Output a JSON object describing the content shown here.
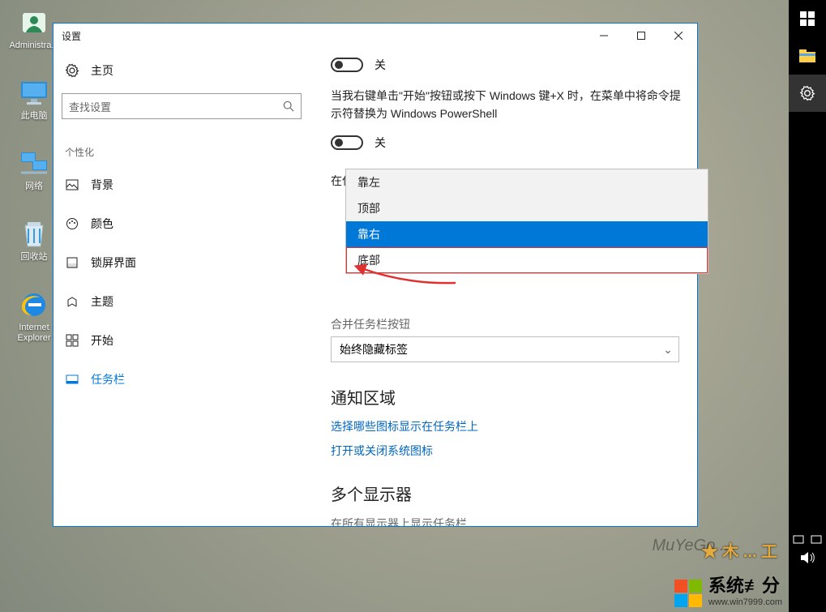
{
  "desktop": {
    "icons": [
      {
        "label": "Administra...",
        "kind": "user"
      },
      {
        "label": "此电脑",
        "kind": "computer"
      },
      {
        "label": "网络",
        "kind": "network"
      },
      {
        "label": "回收站",
        "kind": "recycle"
      },
      {
        "label": "Internet\nExplorer",
        "kind": "ie"
      }
    ]
  },
  "settings_window": {
    "title": "设置",
    "home": "主页",
    "search_placeholder": "查找设置",
    "section": "个性化",
    "nav": [
      {
        "label": "背景"
      },
      {
        "label": "颜色"
      },
      {
        "label": "锁屏界面"
      },
      {
        "label": "主题"
      },
      {
        "label": "开始"
      },
      {
        "label": "任务栏",
        "active": true
      }
    ],
    "content": {
      "toggle1_state": "关",
      "powershell_desc": "当我右键单击\"开始\"按钮或按下 Windows 键+X 时，在菜单中将命令提示符替换为 Windows PowerShell",
      "toggle2_state": "关",
      "badges_label": "在任务栏按钮上显示徽章",
      "position_options": [
        "靠左",
        "顶部",
        "靠右",
        "底部"
      ],
      "position_selected_index": 2,
      "position_highlight_index": 3,
      "combine_partial": "合并任务栏按钮",
      "combine_value": "始终隐藏标签",
      "notif_header": "通知区域",
      "link1": "选择哪些图标显示在任务栏上",
      "link2": "打开或关闭系统图标",
      "multimon_header": "多个显示器",
      "multimon_label": "在所有显示器上显示任务栏"
    }
  },
  "branding": {
    "text": "系统≢分",
    "url": "www.win7999.com"
  },
  "watermark": "MuYeGo...",
  "watermark2": "★ 木 ... 工"
}
